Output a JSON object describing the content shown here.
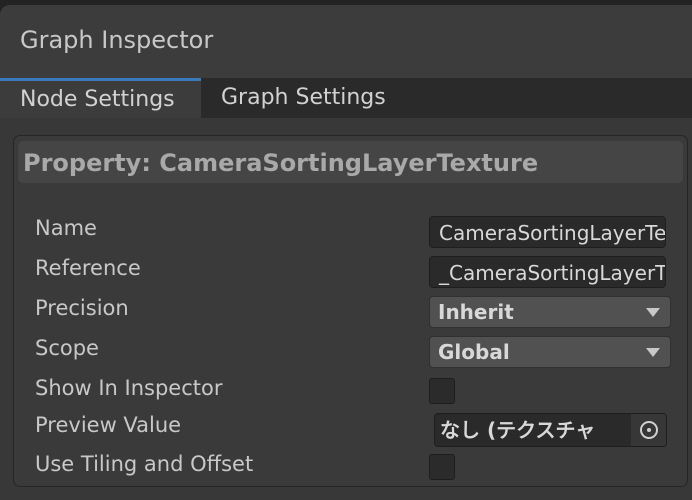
{
  "window": {
    "title": "Graph Inspector"
  },
  "tabs": [
    {
      "label": "Node Settings",
      "active": true
    },
    {
      "label": "Graph Settings",
      "active": false
    }
  ],
  "panel": {
    "title": "Property: CameraSortingLayerTexture",
    "fields": {
      "name": {
        "label": "Name",
        "value": "CameraSortingLayerTexture"
      },
      "reference": {
        "label": "Reference",
        "value": "_CameraSortingLayerTexture"
      },
      "precision": {
        "label": "Precision",
        "value": "Inherit"
      },
      "scope": {
        "label": "Scope",
        "value": "Global"
      },
      "show_in_inspector": {
        "label": "Show In Inspector",
        "checked": false
      },
      "preview_value": {
        "label": "Preview Value",
        "value": "なし (テクスチャ"
      },
      "use_tiling": {
        "label": "Use Tiling and Offset",
        "checked": false
      }
    }
  },
  "colors": {
    "accent": "#3a79bb",
    "background": "#383838"
  }
}
